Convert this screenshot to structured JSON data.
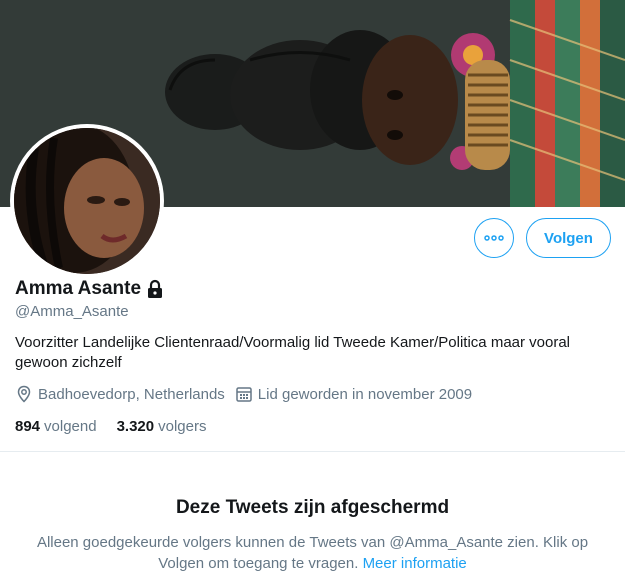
{
  "profile": {
    "display_name": "Amma Asante",
    "handle": "@Amma_Asante",
    "bio": "Voorzitter Landelijke Clientenraad/Voormalig lid Tweede Kamer/Politica maar vooral gewoon zichzelf",
    "location": "Badhoevedorp, Netherlands",
    "joined": "Lid geworden in november 2009",
    "following_count": "894",
    "following_label": "volgend",
    "followers_count": "3.320",
    "followers_label": "volgers",
    "protected": true
  },
  "actions": {
    "follow_label": "Volgen",
    "more_icon": "more-icon"
  },
  "protected_notice": {
    "title": "Deze Tweets zijn afgeschermd",
    "text": "Alleen goedgekeurde volgers kunnen de Tweets van @Amma_Asante zien. Klik op Volgen om toegang te vragen.",
    "link": "Meer informatie"
  },
  "colors": {
    "accent": "#1da1f2",
    "secondary_text": "#657786",
    "primary_text": "#14171a"
  }
}
